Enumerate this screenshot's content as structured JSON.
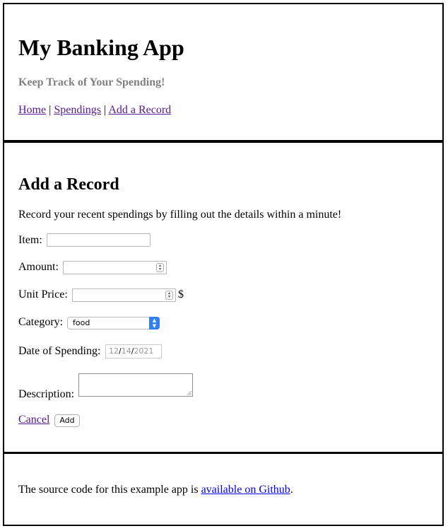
{
  "header": {
    "title": "My Banking App",
    "tagline": "Keep Track of Your Spending!",
    "nav": [
      {
        "label": "Home"
      },
      {
        "label": "Spendings"
      },
      {
        "label": "Add a Record"
      }
    ],
    "separator": "|"
  },
  "main": {
    "title": "Add a Record",
    "intro": "Record your recent spendings by filling out the details within a minute!",
    "form": {
      "item_label": "Item:",
      "item_value": "",
      "amount_label": "Amount:",
      "amount_value": "",
      "unit_price_label": "Unit Price:",
      "unit_price_value": "",
      "currency": "$",
      "category_label": "Category:",
      "category_selected": "food",
      "date_label": "Date of Spending:",
      "date_placeholder": {
        "month": "12",
        "day": "14",
        "year": "2021",
        "sep": "/"
      },
      "description_label": "Description:",
      "description_value": "",
      "cancel_label": "Cancel",
      "add_label": "Add"
    }
  },
  "footer": {
    "text": "The source code for this example app is ",
    "link_label": "available on Github",
    "trailing": "."
  },
  "colors": {
    "link_visited": "#551a8b",
    "link_unvisited": "#0000ee",
    "tagline": "#808080",
    "select_accent": "#2f7ff2"
  }
}
